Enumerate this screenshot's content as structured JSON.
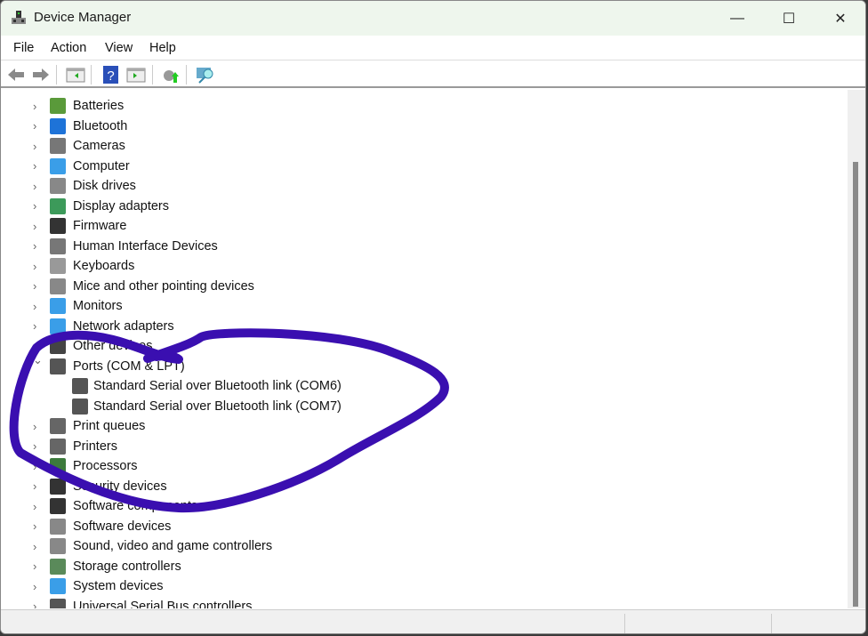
{
  "window": {
    "title": "Device Manager",
    "minimize": "—",
    "maximize": "☐",
    "close": "✕"
  },
  "menu": [
    "File",
    "Action",
    "View",
    "Help"
  ],
  "toolbar": [
    "back-icon",
    "forward-icon",
    "show-hide-console-tree-icon",
    "help-icon",
    "show-action-pane-icon",
    "update-driver-icon",
    "scan-hardware-icon"
  ],
  "tree": [
    {
      "label": "Batteries",
      "icon": "battery-icon",
      "color": "#5a9a3a"
    },
    {
      "label": "Bluetooth",
      "icon": "bluetooth-icon",
      "color": "#1e73d8"
    },
    {
      "label": "Cameras",
      "icon": "camera-icon",
      "color": "#777777"
    },
    {
      "label": "Computer",
      "icon": "computer-icon",
      "color": "#3a9ee8"
    },
    {
      "label": "Disk drives",
      "icon": "disk-drive-icon",
      "color": "#888888"
    },
    {
      "label": "Display adapters",
      "icon": "display-adapter-icon",
      "color": "#3c9a5a"
    },
    {
      "label": "Firmware",
      "icon": "firmware-icon",
      "color": "#333333"
    },
    {
      "label": "Human Interface Devices",
      "icon": "hid-icon",
      "color": "#777777"
    },
    {
      "label": "Keyboards",
      "icon": "keyboard-icon",
      "color": "#999999"
    },
    {
      "label": "Mice and other pointing devices",
      "icon": "mouse-icon",
      "color": "#888888"
    },
    {
      "label": "Monitors",
      "icon": "monitor-icon",
      "color": "#3a9ee8"
    },
    {
      "label": "Network adapters",
      "icon": "network-adapter-icon",
      "color": "#3a9ee8"
    },
    {
      "label": "Other devices",
      "icon": "unknown-device-icon",
      "color": "#444444"
    },
    {
      "label": "Ports (COM & LPT)",
      "icon": "port-icon",
      "color": "#555555",
      "expanded": true,
      "children": [
        {
          "label": "Standard Serial over Bluetooth link (COM6)",
          "icon": "port-icon",
          "color": "#555555"
        },
        {
          "label": "Standard Serial over Bluetooth link (COM7)",
          "icon": "port-icon",
          "color": "#555555"
        }
      ]
    },
    {
      "label": "Print queues",
      "icon": "printer-icon",
      "color": "#666666"
    },
    {
      "label": "Printers",
      "icon": "printer-icon",
      "color": "#666666"
    },
    {
      "label": "Processors",
      "icon": "processor-icon",
      "color": "#3c7a3c"
    },
    {
      "label": "Security devices",
      "icon": "security-device-icon",
      "color": "#333333"
    },
    {
      "label": "Software components",
      "icon": "software-component-icon",
      "color": "#333333"
    },
    {
      "label": "Software devices",
      "icon": "software-device-icon",
      "color": "#888888"
    },
    {
      "label": "Sound, video and game controllers",
      "icon": "speaker-icon",
      "color": "#888888"
    },
    {
      "label": "Storage controllers",
      "icon": "storage-controller-icon",
      "color": "#5a8a5a"
    },
    {
      "label": "System devices",
      "icon": "system-device-icon",
      "color": "#3a9ee8"
    },
    {
      "label": "Universal Serial Bus controllers",
      "icon": "usb-icon",
      "color": "#555555"
    }
  ],
  "annotation_color": "#3a0fb0"
}
